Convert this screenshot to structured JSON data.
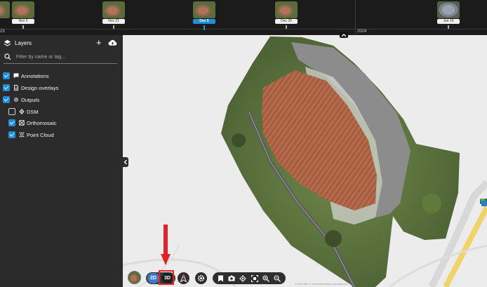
{
  "timeline": {
    "years": [
      "23",
      "2024"
    ],
    "items": [
      {
        "label": "Nov 6",
        "active": false
      },
      {
        "label": "Nov 21",
        "active": false
      },
      {
        "label": "Dec 6",
        "active": true
      },
      {
        "label": "Dec 20",
        "active": false
      },
      {
        "label": "Jan 16",
        "active": false
      }
    ]
  },
  "sidebar": {
    "title": "Layers",
    "search_placeholder": "Filter by name or tag...",
    "layers": [
      {
        "label": "Annotations",
        "checked": true,
        "icon": "comment-icon"
      },
      {
        "label": "Design overlays",
        "checked": true,
        "icon": "document-icon"
      },
      {
        "label": "Outputs",
        "checked": true,
        "icon": "gear-icon"
      },
      {
        "label": "DSM",
        "checked": false,
        "icon": "dsm-icon"
      },
      {
        "label": "Orthomosaic",
        "checked": true,
        "icon": "orthomosaic-icon"
      },
      {
        "label": "Point Cloud",
        "checked": true,
        "icon": "point-cloud-icon"
      }
    ]
  },
  "toolbar": {
    "view_2d": "2D",
    "view_3d": "3D",
    "highlight_color": "#e0242a",
    "accent_color": "#1e8fd8"
  },
  "map": {
    "attribution": "© MapTiler © OpenStreetMap contributors",
    "road_label": "10"
  }
}
